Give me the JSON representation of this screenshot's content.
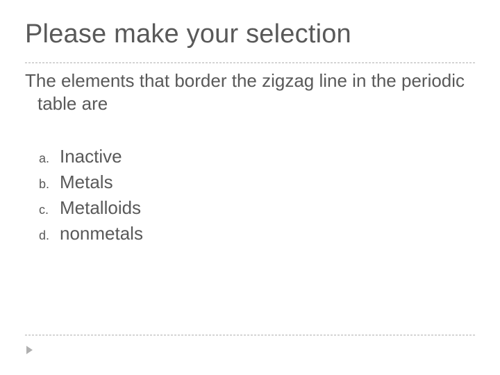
{
  "slide": {
    "title": "Please make your selection",
    "question": "The elements that border the zigzag line in the periodic table are",
    "options": [
      {
        "marker": "a.",
        "text": "Inactive"
      },
      {
        "marker": "b.",
        "text": "Metals"
      },
      {
        "marker": "c.",
        "text": "Metalloids"
      },
      {
        "marker": "d.",
        "text": "nonmetals"
      }
    ]
  }
}
